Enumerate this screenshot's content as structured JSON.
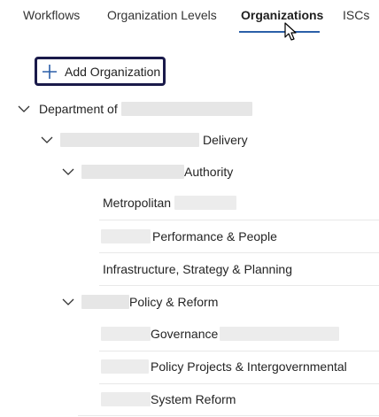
{
  "tabs": [
    {
      "label": "Workflows"
    },
    {
      "label": "Organization Levels"
    },
    {
      "label": "Organizations"
    },
    {
      "label": "ISCs"
    }
  ],
  "active_tab": "Organizations",
  "add_button": {
    "label": "Add Organization",
    "icon": "plus-icon"
  },
  "tree": {
    "root": {
      "label": "Department of"
    },
    "delivery": {
      "label": "Delivery"
    },
    "authority": {
      "label": "Authority"
    },
    "metropolitan": {
      "label": "Metropolitan"
    },
    "performance": {
      "label": "Performance & People"
    },
    "infrastructure": {
      "label": "Infrastructure, Strategy & Planning"
    },
    "policy_reform": {
      "label": "Policy & Reform"
    },
    "governance": {
      "label": "Governance"
    },
    "policy_projects": {
      "label": "Policy Projects & Intergovernmental"
    },
    "system_reform": {
      "label": "System Reform"
    }
  },
  "colors": {
    "accent": "#2b5fa8",
    "button_border": "#1a1a4a",
    "redaction": "#e6e6e6"
  }
}
